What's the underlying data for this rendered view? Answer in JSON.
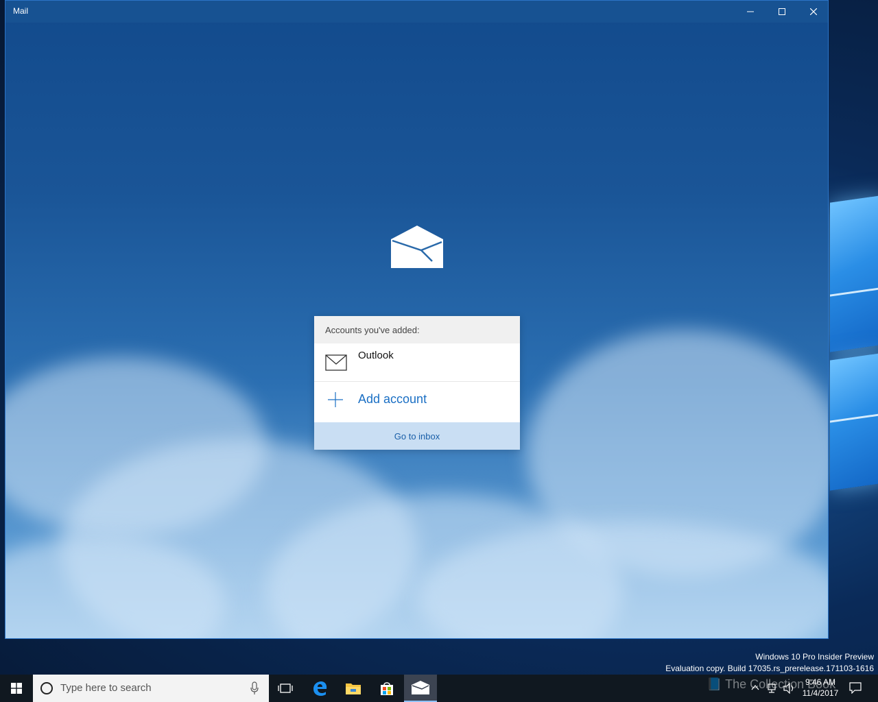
{
  "window": {
    "title": "Mail"
  },
  "accounts_card": {
    "header": "Accounts you've added:",
    "accounts": [
      {
        "name": "Outlook",
        "icon": "envelope-icon"
      }
    ],
    "add_account_label": "Add account",
    "go_to_inbox_label": "Go to inbox"
  },
  "watermark": {
    "line1": "Windows 10 Pro Insider Preview",
    "line2": "Evaluation copy. Build 17035.rs_prerelease.171103-1616"
  },
  "taskbar": {
    "search_placeholder": "Type here to search",
    "clock_time": "9:46 AM",
    "clock_date": "11/4/2017",
    "brand_text": "The Collection Book"
  },
  "colors": {
    "accent": "#1a6fc4",
    "titlebar": "#175292",
    "inbox_button": "#c9def3"
  }
}
